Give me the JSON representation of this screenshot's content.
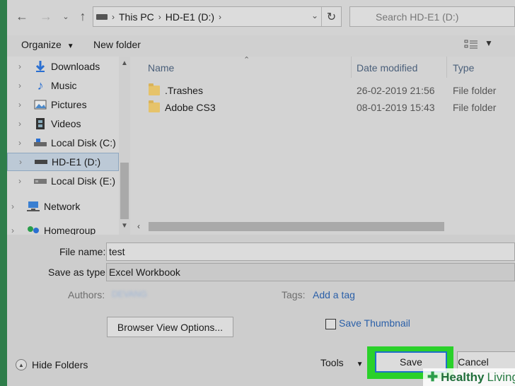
{
  "address_bar": {
    "crumbs": [
      "This PC",
      "HD-E1 (D:)"
    ],
    "search_placeholder": "Search HD-E1 (D:)"
  },
  "toolbar": {
    "organize_label": "Organize",
    "new_folder_label": "New folder"
  },
  "nav_pane": {
    "items": [
      {
        "label": "Downloads",
        "icon": "download-arrow-icon"
      },
      {
        "label": "Music",
        "icon": "music-note-icon"
      },
      {
        "label": "Pictures",
        "icon": "pictures-icon"
      },
      {
        "label": "Videos",
        "icon": "video-film-icon"
      },
      {
        "label": "Local Disk (C:)",
        "icon": "drive-icon"
      },
      {
        "label": "HD-E1 (D:)",
        "icon": "drive-icon",
        "selected": true
      },
      {
        "label": "Local Disk (E:)",
        "icon": "drive-icon"
      },
      {
        "label": "Network",
        "icon": "network-icon"
      },
      {
        "label": "Homegroup",
        "icon": "homegroup-icon"
      }
    ]
  },
  "file_list": {
    "columns": {
      "name": "Name",
      "date_modified": "Date modified",
      "type": "Type"
    },
    "rows": [
      {
        "name": ".Trashes",
        "date": "26-02-2019 21:56",
        "type": "File folder"
      },
      {
        "name": "Adobe CS3",
        "date": "08-01-2019 15:43",
        "type": "File folder"
      }
    ]
  },
  "form": {
    "file_name_label": "File name:",
    "file_name_value": "test",
    "save_type_label": "Save as type:",
    "save_type_value": "Excel Workbook",
    "authors_label": "Authors:",
    "authors_value": "DEVANG",
    "tags_label": "Tags:",
    "tags_link": "Add a tag",
    "browser_view_label": "Browser View Options...",
    "save_thumbnail_label": "Save Thumbnail",
    "save_thumbnail_checked": false
  },
  "footer": {
    "hide_folders_label": "Hide Folders",
    "tools_label": "Tools",
    "save_label": "Save",
    "cancel_label": "Cancel"
  },
  "watermark": {
    "brand_bold": "Healthy",
    "brand_light": "Living"
  },
  "colors": {
    "highlight_green": "#2ad12a",
    "link_blue": "#2a5fa8",
    "selection_blue": "#bcc9d6"
  }
}
